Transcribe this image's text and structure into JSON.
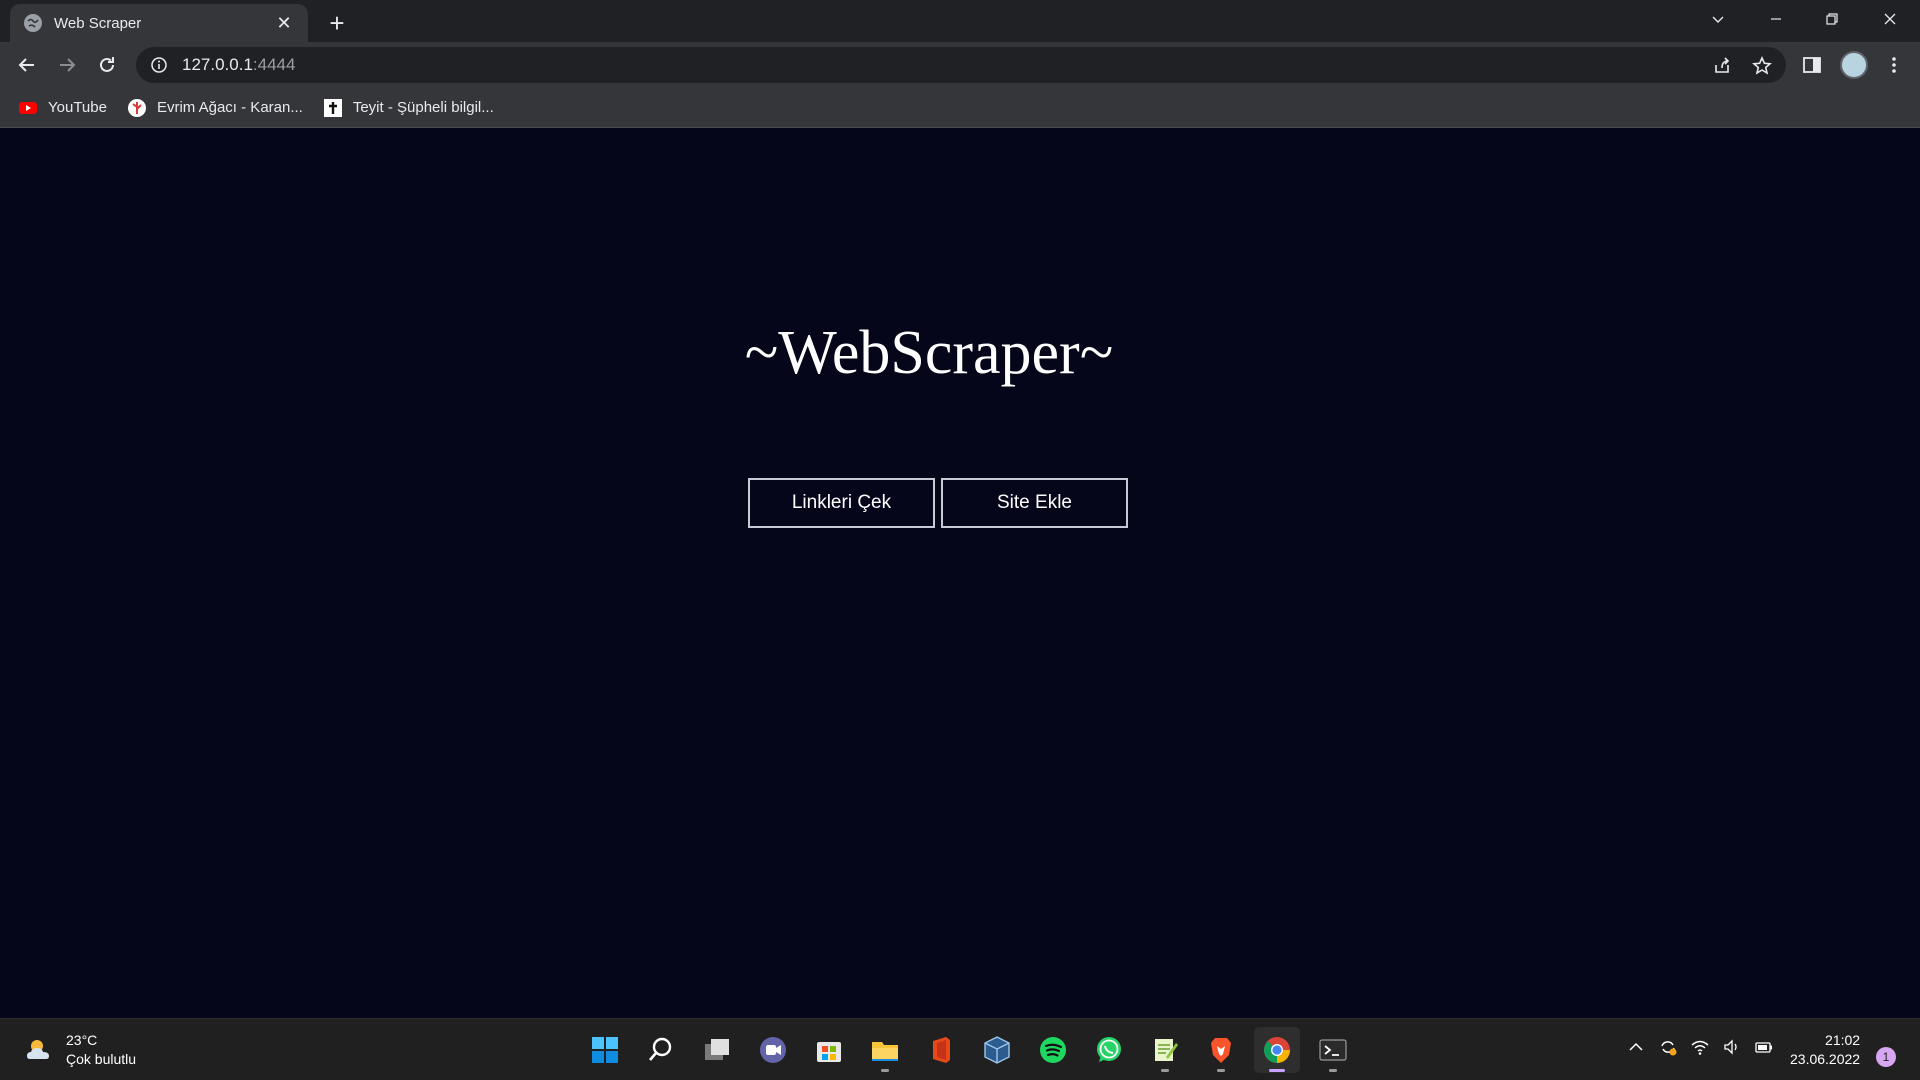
{
  "browser": {
    "tab_title": "Web Scraper",
    "url_host": "127.0.0.1",
    "url_port": ":4444",
    "bookmarks": [
      {
        "label": "YouTube",
        "icon": "youtube-icon"
      },
      {
        "label": "Evrim Ağacı - Karan...",
        "icon": "evrim-agaci-icon"
      },
      {
        "label": "Teyit - Şüpheli bilgil...",
        "icon": "teyit-icon"
      }
    ]
  },
  "page": {
    "title": "~WebScraper~",
    "buttons": {
      "fetch_links": "Linkleri Çek",
      "add_site": "Site Ekle"
    }
  },
  "taskbar": {
    "weather_temp": "23°C",
    "weather_desc": "Çok bulutlu",
    "time": "21:02",
    "date": "23.06.2022",
    "notification_count": "1",
    "apps": [
      "windows-start-icon",
      "search-icon",
      "task-view-icon",
      "teams-chat-icon",
      "store-icon",
      "file-explorer-icon",
      "office-icon",
      "virtualbox-icon",
      "spotify-icon",
      "whatsapp-icon",
      "notepadpp-icon",
      "brave-icon",
      "chrome-icon",
      "terminal-icon"
    ]
  },
  "colors": {
    "page_bg": "#05061a",
    "chrome_dark": "#202124",
    "chrome_toolbar": "#35363a",
    "button_border": "#c8cad6"
  }
}
